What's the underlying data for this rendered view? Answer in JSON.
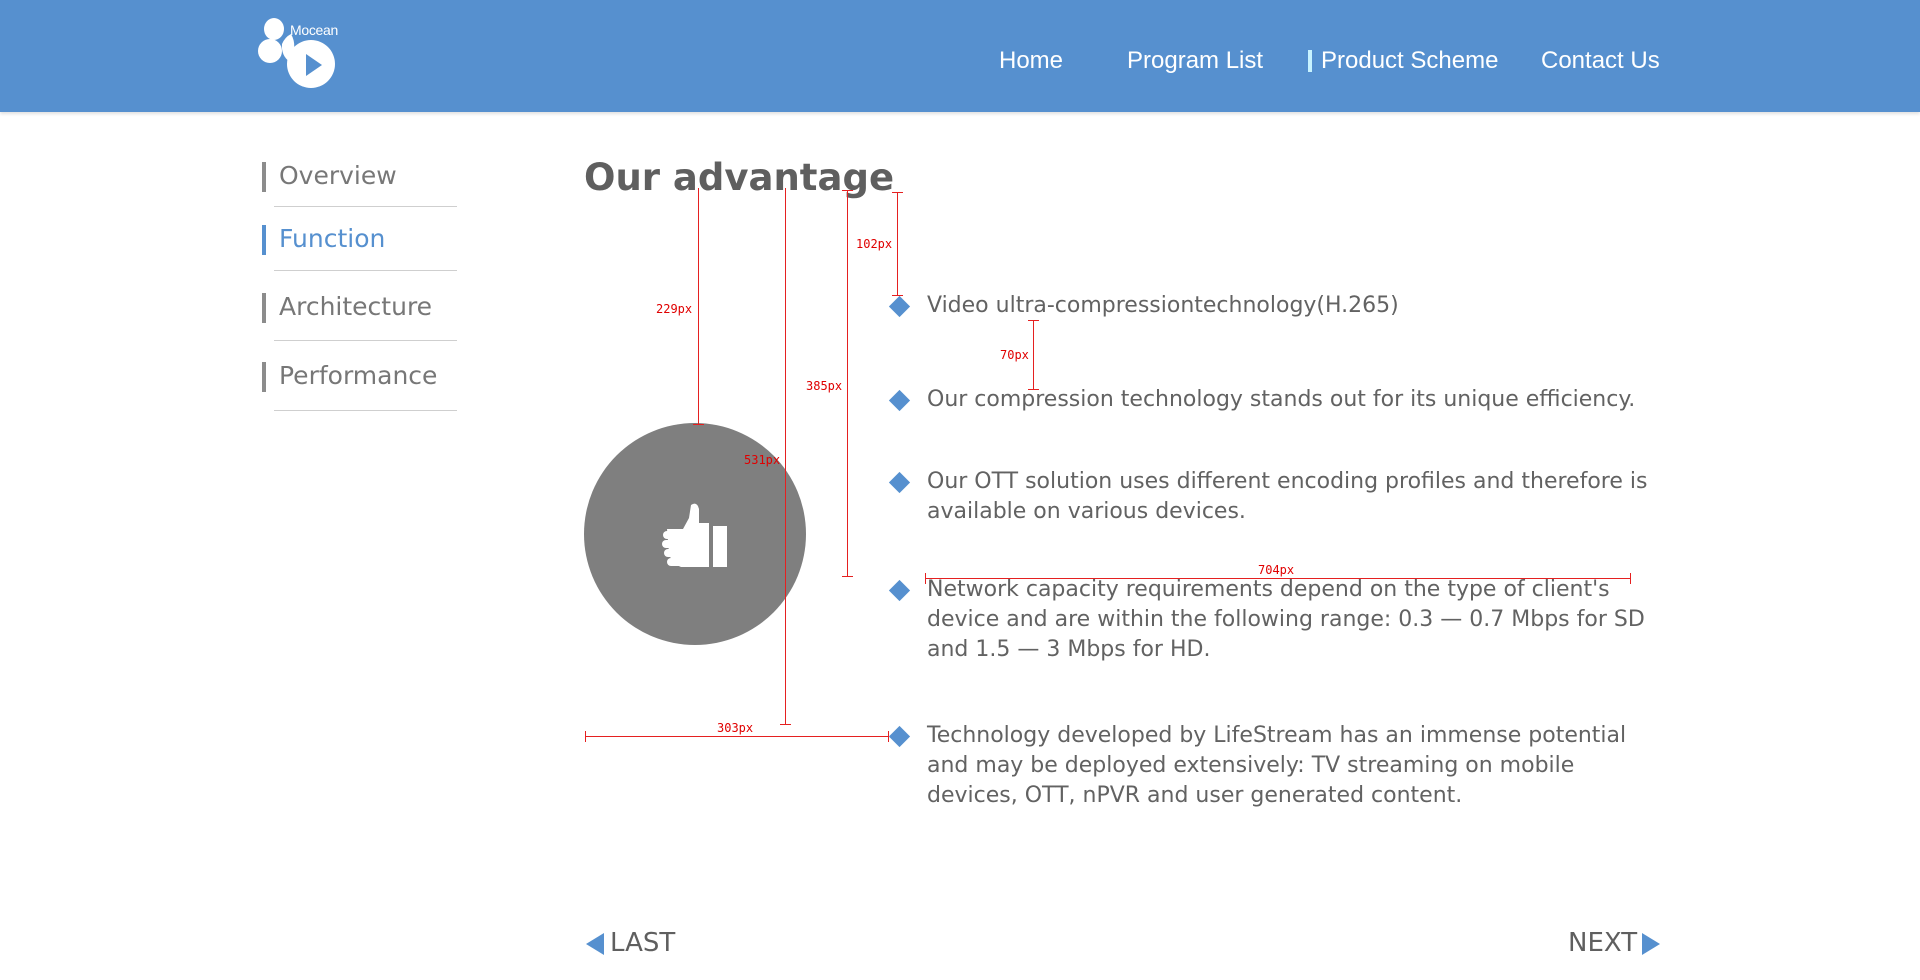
{
  "header": {
    "logo_text": "Mocean",
    "nav": [
      {
        "label": "Home"
      },
      {
        "label": "Program List"
      },
      {
        "label": "Product Scheme"
      },
      {
        "label": "Contact Us"
      }
    ],
    "active_nav": "Product Scheme",
    "bg_color": "#5690cf"
  },
  "sidebar": {
    "items": [
      {
        "label": "Overview"
      },
      {
        "label": "Function"
      },
      {
        "label": "Architecture"
      },
      {
        "label": "Performance"
      }
    ],
    "active_item": "Function"
  },
  "main": {
    "title": "Our advantage",
    "icon": "thumbs-up-icon",
    "points": [
      "Video ultra-compressiontechnology(H.265)",
      "Our compression technology stands out for its unique efficiency.",
      "Our OTT solution uses different encoding profiles and therefore is available on various devices.",
      "Network capacity requirements depend on the type of client's device and are within the following range: 0.3 — 0.7 Mbps for SD and 1.5 — 3 Mbps for HD.",
      "Technology developed by LifeStream has an immense potential and may be deployed extensively: TV streaming on mobile devices, OTT, nPVR and user generated content."
    ]
  },
  "annotations": {
    "a229": "229px",
    "a531": "531px",
    "a385": "385px",
    "a102": "102px",
    "a70": "70px",
    "a704": "704px",
    "a303": "303px"
  },
  "pager": {
    "last_label": "LAST",
    "next_label": "NEXT"
  },
  "colors": {
    "accent": "#5690cf",
    "annotation": "#e52020",
    "circle": "#7f7f7f"
  }
}
